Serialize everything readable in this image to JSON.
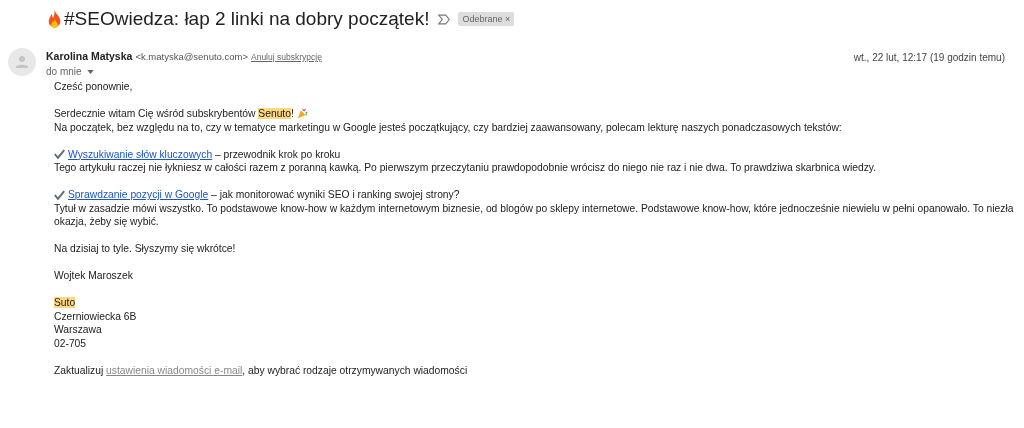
{
  "subject": "#SEOwiedza: łap 2 linki na dobry początek!",
  "label": {
    "text": "Odebrane",
    "close": "×"
  },
  "sender": {
    "name": "Karolina Matyska",
    "email": "<k.matyska@senuto.com>",
    "unsubscribe": "Anuluj subskrypcję",
    "to": "do mnie",
    "date": "wt., 22 lut, 12:17 (19 godzin temu)"
  },
  "body": {
    "greeting": "Cześć ponownie,",
    "welcome": {
      "before": "Serdecznie witam Cię wśród subskrybentów ",
      "highlight": "Senuto",
      "after": "!"
    },
    "intro": "Na początek, bez względu na to, czy w tematyce marketingu w Google jesteś początkujący, czy bardziej zaawansowany, polecam lekturę naszych ponadczasowych tekstów:",
    "articles": [
      {
        "link": "Wyszukiwanie słów kluczowych",
        "tagline": " – przewodnik krok po kroku",
        "description": "Tego artykułu raczej nie łykniesz w całości razem z poranną kawką. Po pierwszym przeczytaniu prawdopodobnie wrócisz do niego nie raz i nie dwa. To prawdziwa skarbnica wiedzy."
      },
      {
        "link": "Sprawdzanie pozycji w Google",
        "tagline": " – jak monitorować wyniki SEO i ranking swojej strony?",
        "description": "Tytuł w zasadzie mówi wszystko. To podstawowe know-how w każdym internetowym biznesie, od blogów po sklepy internetowe. Podstawowe know-how, które jednocześnie niewielu w pełni opanowało. To niezła okazja, żeby się wybić."
      }
    ],
    "closing": "Na dzisiaj to tyle. Słyszymy się wkrótce!",
    "signature": "Wojtek Maroszek",
    "address": [
      {
        "text": "Suto",
        "highlight": true
      },
      {
        "text": "Czerniowiecka 6B",
        "highlight": false
      },
      {
        "text": "Warszawa",
        "highlight": false
      },
      {
        "text": "02-705",
        "highlight": false
      }
    ],
    "footer": {
      "before": "Zaktualizuj ",
      "link": "ustawienia wiadomości e-mail",
      "after": ", aby wybrać rodzaje otrzymywanych wiadomości"
    }
  }
}
